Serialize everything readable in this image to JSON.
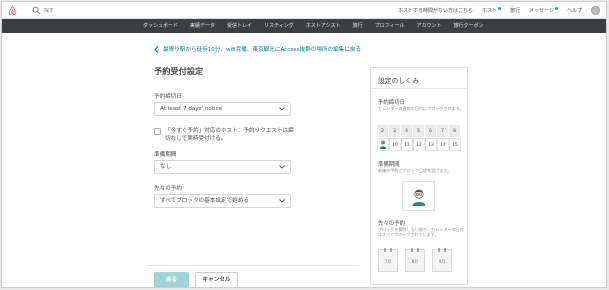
{
  "header": {
    "search_placeholder": "探す",
    "links": [
      {
        "label": "ホストする時間がない方はこちら",
        "dot": false
      },
      {
        "label": "ホスト",
        "dot": true
      },
      {
        "label": "旅行",
        "dot": false
      },
      {
        "label": "メッセージ",
        "dot": true
      },
      {
        "label": "ヘルプ",
        "dot": false
      }
    ]
  },
  "nav": {
    "items": [
      "ダッシュボード",
      "実績データ",
      "受信トレイ",
      "リスティング",
      "ホストアシスト",
      "旅行",
      "プロフィール",
      "アカウント",
      "旅行クーポン"
    ]
  },
  "back_link": "最寄り駅から徒歩10分、wifi完備、東京観光にAccess抜群の場所の編集に戻る",
  "form": {
    "title": "予約受付設定",
    "deadline_label": "予約締切日",
    "deadline_value": "At least 7 days' notice",
    "instant_book_text": "「今すぐ予約」対応のホスト：予約リクエストは締切なしで実時受付ける。",
    "buffer_label": "準備期間",
    "buffer_value": "なし",
    "future_label": "先々の予約",
    "future_value": "すべてブロックの基本設定で始める"
  },
  "footer": {
    "back_label": "戻る",
    "cancel_label": "キャンセル"
  },
  "panel": {
    "title": "設定のしくみ",
    "deadline_head": "予約締切日",
    "deadline_desc": "カレンダーの直前の日付にブロックされます。",
    "calendar_days": [
      "2",
      "3",
      "4",
      "5",
      "6",
      "7",
      "8",
      "",
      "10",
      "11",
      "12",
      "13",
      "14",
      "15"
    ],
    "buffer_head": "準備期間",
    "buffer_desc": "前後の予約とブロック日程を設けます。",
    "future_head": "先々の予約",
    "future_desc": "ブロックを解除しない限り、カレンダーの日付はすべてブロックされています。",
    "months": [
      "7月",
      "8月",
      "9月"
    ]
  },
  "colors": {
    "accent": "#007a87",
    "nav_bg": "#3b3e44",
    "back_button": "#9ed6d7",
    "brand": "#ff5a5f",
    "status_dot": "#00a699"
  }
}
